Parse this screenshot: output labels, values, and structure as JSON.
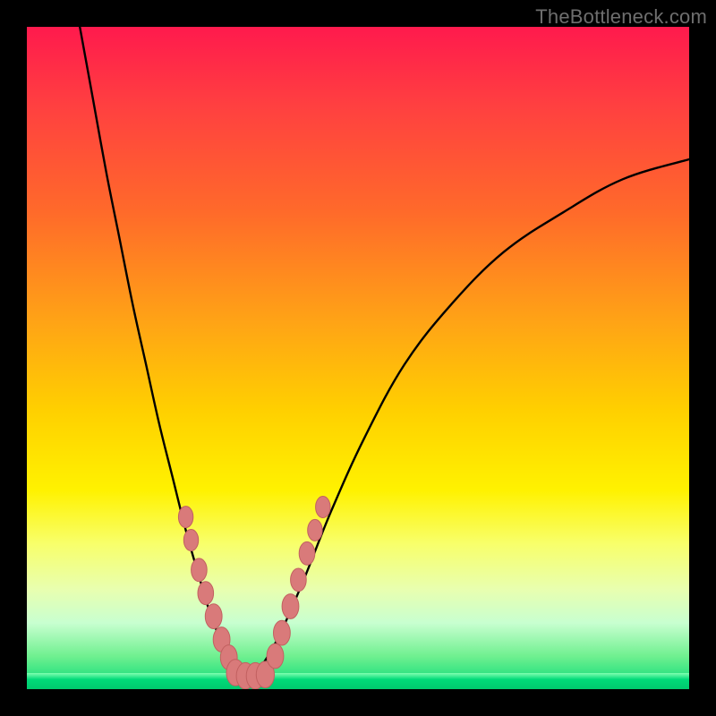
{
  "watermark": "TheBottleneck.com",
  "colors": {
    "frame": "#000000",
    "gradient_top": "#ff1a4d",
    "gradient_bottom": "#00d976",
    "curve": "#000000",
    "bead_fill": "#d97a7a",
    "bead_stroke": "#c26060"
  },
  "chart_data": {
    "type": "line",
    "title": "",
    "xlabel": "",
    "ylabel": "",
    "xlim": [
      0,
      100
    ],
    "ylim": [
      0,
      100
    ],
    "grid": false,
    "legend": false,
    "description": "Two bottleneck curves against a vertical thermal gradient (red=bad high, green=good low). Left branch drops steeply from top-left into a flat minimum near the bottom then a second branch rises to the upper-right with gentler curvature. Pink beads mark sample points clustered around the minimum.",
    "series": [
      {
        "name": "left-branch",
        "x": [
          8,
          10,
          12,
          14,
          16,
          18,
          20,
          22,
          24,
          26,
          27.5,
          29,
          30.5,
          32,
          33.5
        ],
        "y": [
          100,
          89,
          78,
          68,
          58,
          49,
          40,
          32,
          24,
          17,
          12,
          8,
          5,
          3,
          2
        ]
      },
      {
        "name": "right-branch",
        "x": [
          33.5,
          35,
          37,
          39,
          42,
          46,
          51,
          57,
          64,
          72,
          81,
          90,
          100
        ],
        "y": [
          2,
          3,
          6,
          10,
          17,
          27,
          38,
          49,
          58,
          66,
          72,
          77,
          80
        ]
      }
    ],
    "beads_left": [
      {
        "x": 24.0,
        "y": 26.0,
        "r": 1.3
      },
      {
        "x": 24.8,
        "y": 22.5,
        "r": 1.3
      },
      {
        "x": 26.0,
        "y": 18.0,
        "r": 1.4
      },
      {
        "x": 27.0,
        "y": 14.5,
        "r": 1.4
      },
      {
        "x": 28.2,
        "y": 11.0,
        "r": 1.5
      },
      {
        "x": 29.4,
        "y": 7.5,
        "r": 1.5
      },
      {
        "x": 30.5,
        "y": 4.8,
        "r": 1.5
      }
    ],
    "beads_bottom": [
      {
        "x": 31.5,
        "y": 2.5,
        "r": 1.6
      },
      {
        "x": 33.0,
        "y": 2.0,
        "r": 1.6
      },
      {
        "x": 34.5,
        "y": 2.0,
        "r": 1.6
      },
      {
        "x": 36.0,
        "y": 2.2,
        "r": 1.6
      }
    ],
    "beads_right": [
      {
        "x": 37.5,
        "y": 5.0,
        "r": 1.5
      },
      {
        "x": 38.5,
        "y": 8.5,
        "r": 1.5
      },
      {
        "x": 39.8,
        "y": 12.5,
        "r": 1.5
      },
      {
        "x": 41.0,
        "y": 16.5,
        "r": 1.4
      },
      {
        "x": 42.3,
        "y": 20.5,
        "r": 1.4
      },
      {
        "x": 43.5,
        "y": 24.0,
        "r": 1.3
      },
      {
        "x": 44.7,
        "y": 27.5,
        "r": 1.3
      }
    ]
  }
}
